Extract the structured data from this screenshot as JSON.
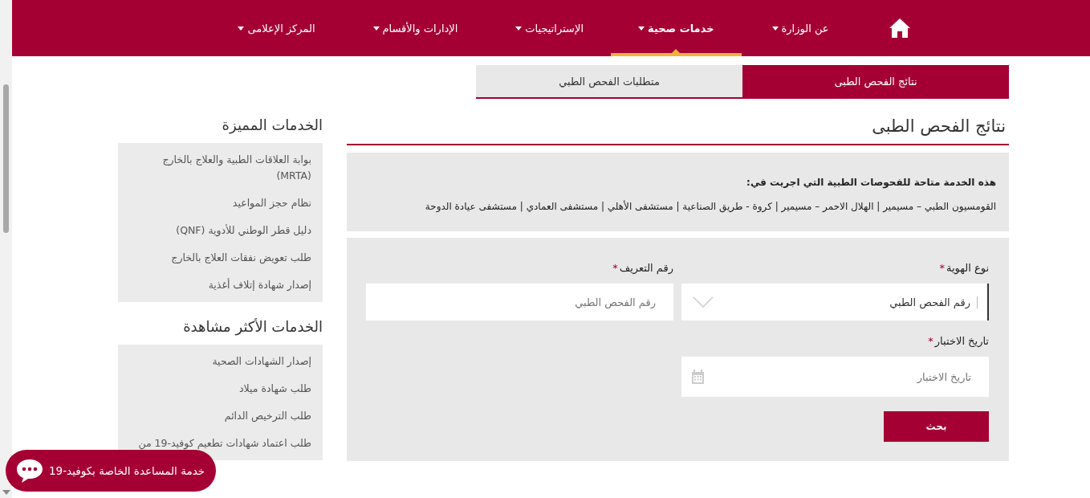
{
  "nav": {
    "items": [
      {
        "label": "عن الوزارة",
        "dropdown": true,
        "selected": false
      },
      {
        "label": "خدمات صحية",
        "dropdown": true,
        "selected": true
      },
      {
        "label": "الإستراتيجيات",
        "dropdown": true,
        "selected": false
      },
      {
        "label": "الإدارات والأقسام",
        "dropdown": true,
        "selected": false
      },
      {
        "label": "المركز الإعلامى",
        "dropdown": true,
        "selected": false
      }
    ]
  },
  "tabs": [
    {
      "label": "نتائج الفحص الطبى",
      "selected": true
    },
    {
      "label": "متطلبات الفحص الطبي",
      "selected": false
    }
  ],
  "page_title": "نتائج الفحص الطبى",
  "notice": {
    "heading": "هذه الخدمة متاحة للفحوصات الطبية التي اجريت في:",
    "text": "القومسيون الطبي – مسيمير | الهلال الاحمر – مسيمير | كروة - طريق الصناعية | مستشفى الأهلي | مستشفى العمادي | مستشفى عيادة الدوحة"
  },
  "form": {
    "fields": [
      {
        "kind": "select",
        "label": "نوع الهوية",
        "required_mark": "*",
        "value": "رقم الفحص الطبي"
      },
      {
        "kind": "text",
        "label": "رقم التعريف",
        "required_mark": "*",
        "placeholder": "رقم الفحص الطبي"
      },
      {
        "kind": "date",
        "label": "تاريخ الاختبار",
        "required_mark": "*",
        "placeholder": "تاريخ الاختبار"
      }
    ],
    "submit": "بحث"
  },
  "sidebar": {
    "sections": [
      {
        "title": "الخدمات المميزة",
        "items": [
          "بوابة العلاقات الطبية والعلاج بالخارج (MRTA)",
          "نظام حجز المواعيد",
          "دليل قطر الوطني للأدوية (QNF)",
          "طلب تعويض نفقات العلاج بالخارج",
          "إصدار شهادة إتلاف أغذية"
        ]
      },
      {
        "title": "الخدمات الأكثر مشاهدة",
        "items": [
          "إصدار الشهادات الصحية",
          "طلب شهادة ميلاد",
          "طلب الترخيص الدائم",
          "طلب اعتماد شهادات تطعيم كوفيد-19 من"
        ]
      }
    ]
  },
  "chat_button": {
    "label": "خدمة المساعدة الخاصة بكوفيد-19"
  }
}
